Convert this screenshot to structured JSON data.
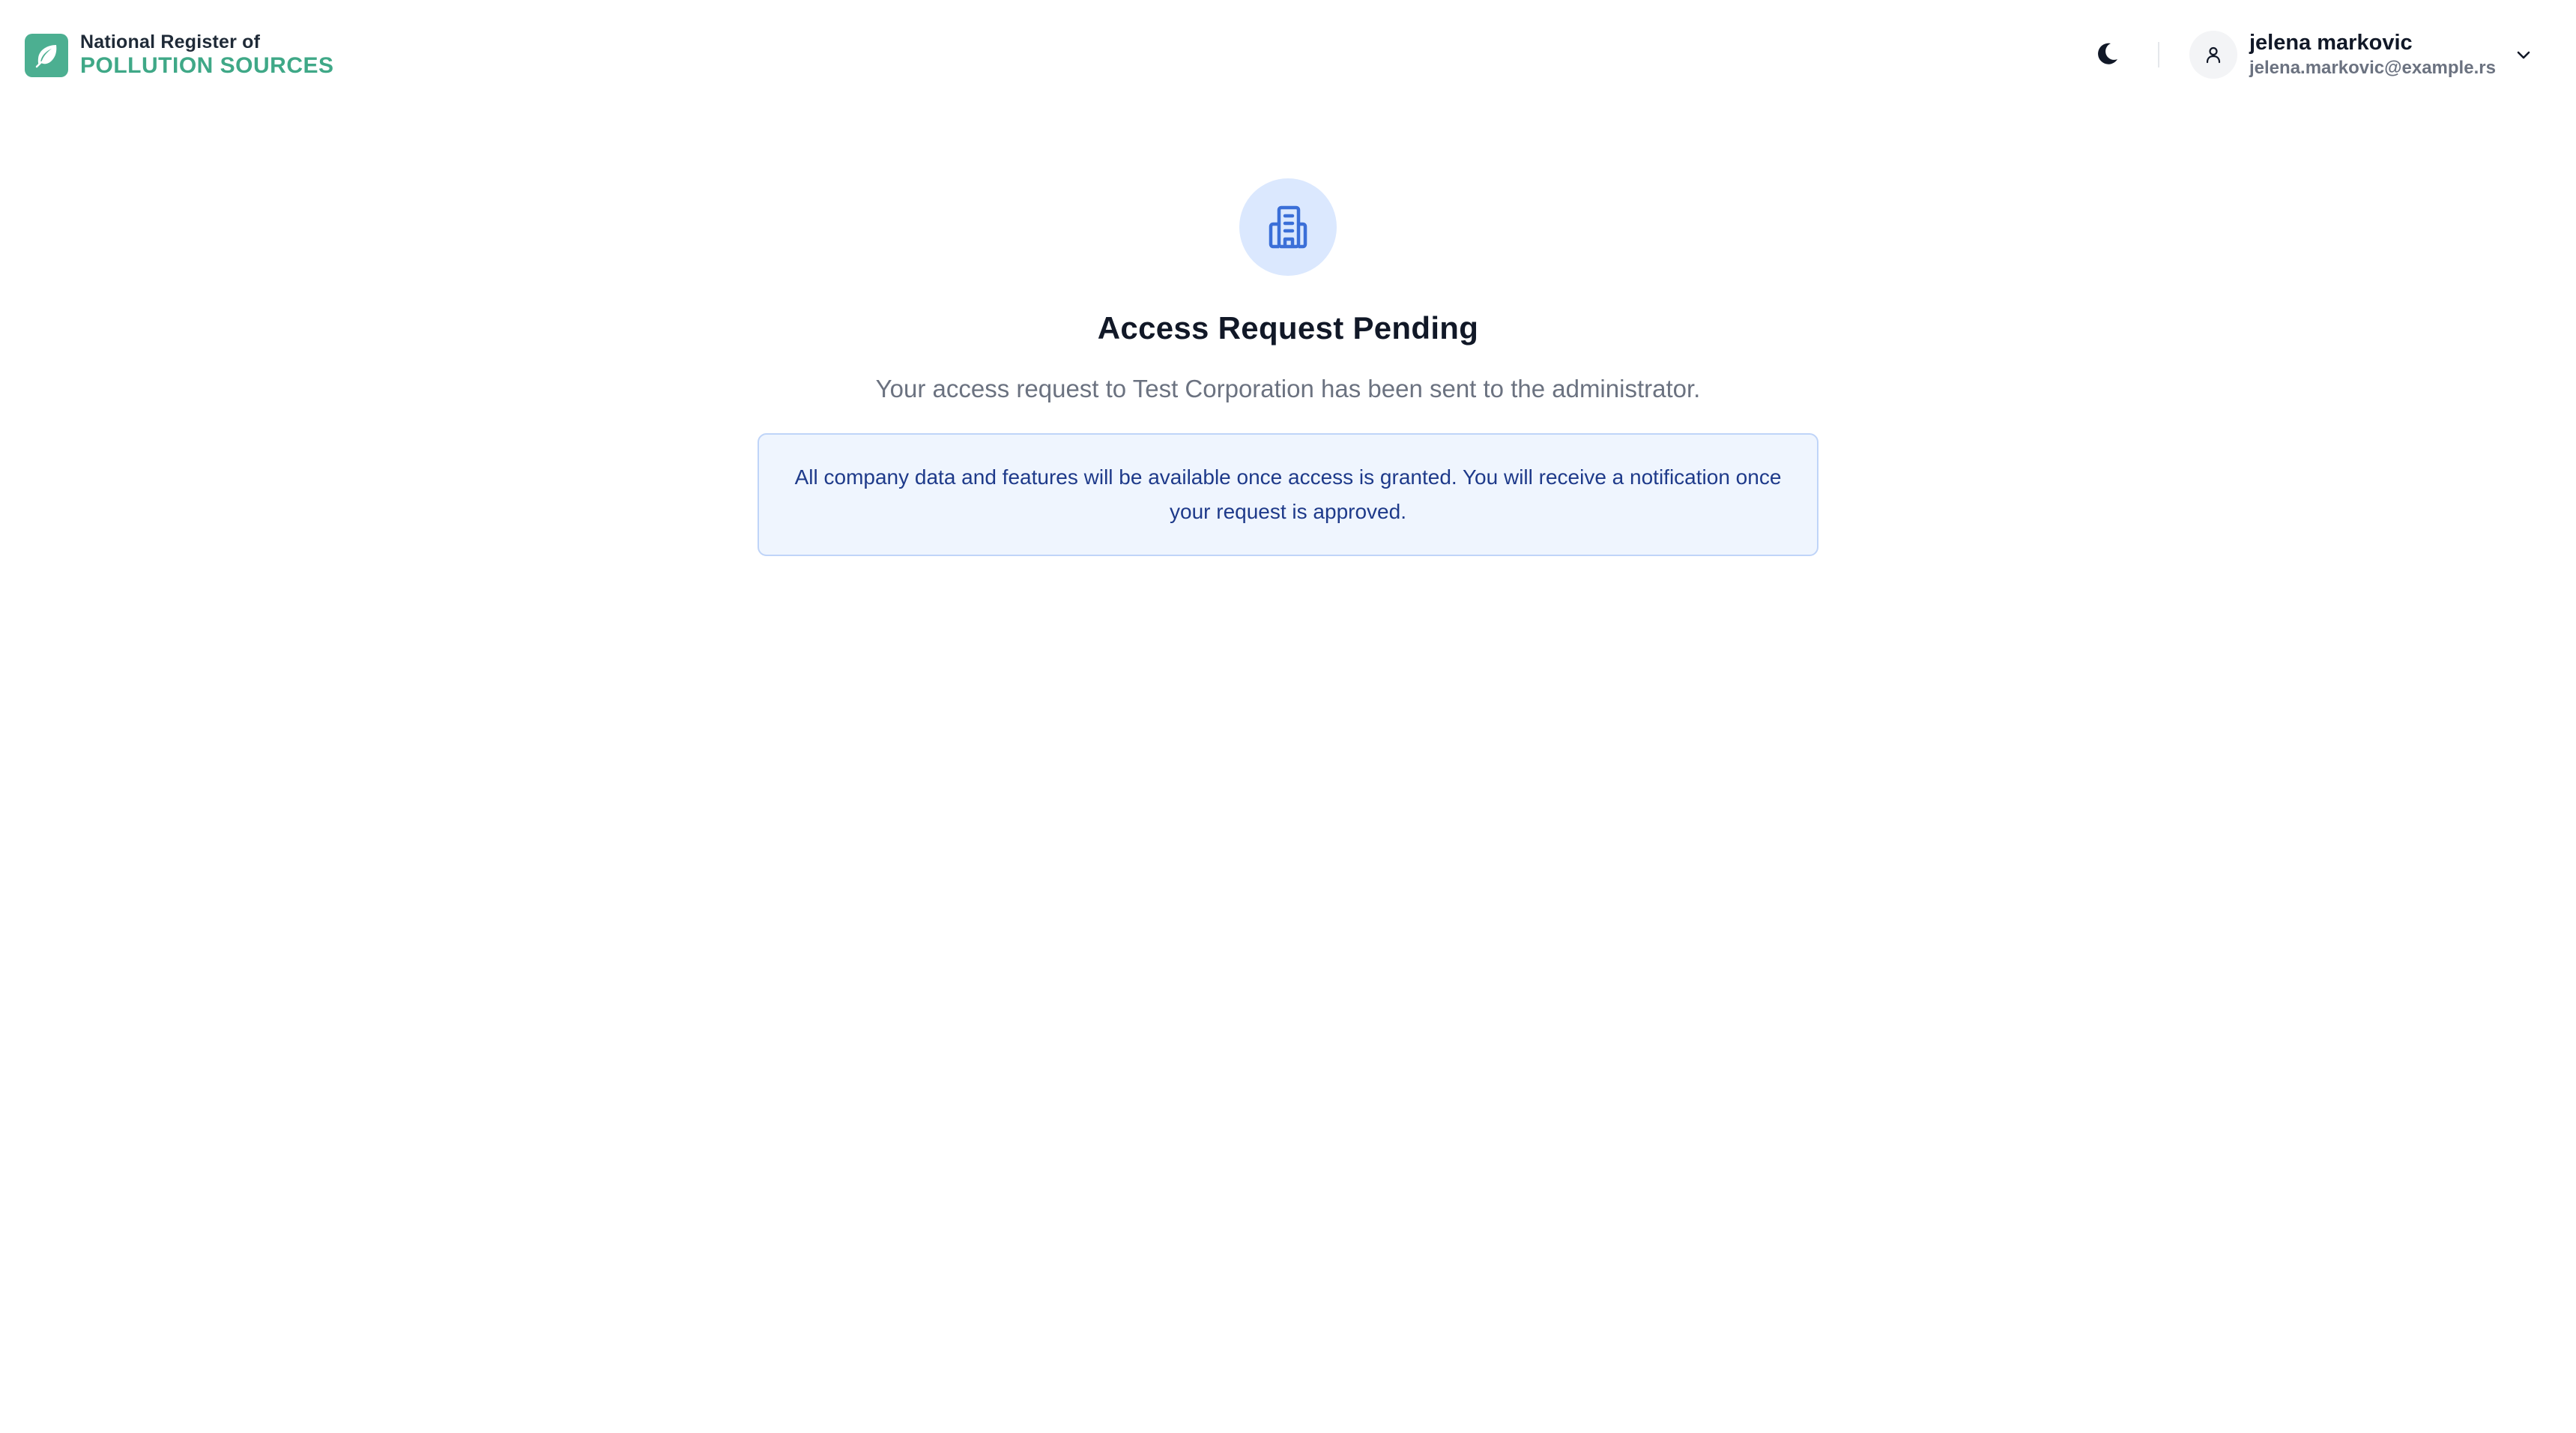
{
  "header": {
    "logo": {
      "line1": "National Register of",
      "line2": "POLLUTION SOURCES",
      "icon": "leaf-icon",
      "color": "#4caf91"
    },
    "theme_toggle": {
      "icon": "moon-icon"
    },
    "user": {
      "name": "jelena markovic",
      "email": "jelena.markovic@example.rs",
      "avatar_icon": "user-icon",
      "menu_icon": "chevron-down-icon"
    }
  },
  "main": {
    "icon": "building-icon",
    "title": "Access Request Pending",
    "subtitle": "Your access request to Test Corporation has been sent to the administrator.",
    "notice": "All company data and features will be available once access is granted. You will receive a notification once your request is approved.",
    "colors": {
      "icon_circle": "#dbe8fe",
      "icon": "#3b6fd8",
      "notice_bg": "#eff5fe",
      "notice_border": "#bfd4f8",
      "notice_text": "#1e3a8a"
    }
  }
}
